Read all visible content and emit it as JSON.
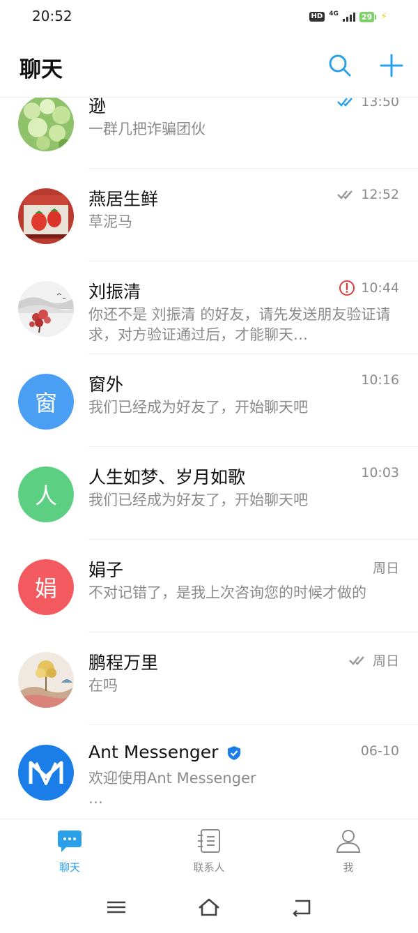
{
  "status_bar": {
    "time": "20:52",
    "hd": "HD",
    "network": "4G",
    "battery": "29"
  },
  "header": {
    "title": "聊天",
    "search_icon": "search-icon",
    "add_icon": "plus-icon"
  },
  "accent_color": "#2aa0e8",
  "chats": [
    {
      "name": "逊",
      "preview": "一群几把诈骗团伙",
      "time": "13:50",
      "status": "read-blue",
      "avatar_type": "photo-flowers"
    },
    {
      "name": "燕居生鲜",
      "preview": "草泥马",
      "time": "12:52",
      "status": "read",
      "avatar_type": "photo-strawberries"
    },
    {
      "name": "刘振清",
      "preview": "你还不是 刘振清 的好友，请先发送朋友验证请求，对方验证通过后，才能聊天…",
      "time": "10:44",
      "status": "error",
      "avatar_type": "photo-painting"
    },
    {
      "name": "窗外",
      "preview": "我们已经成为好友了，开始聊天吧",
      "time": "10:16",
      "status": "none",
      "avatar_letter": "窗",
      "avatar_color": "#4a9ff5"
    },
    {
      "name": "人生如梦、岁月如歌",
      "preview": "我们已经成为好友了，开始聊天吧",
      "time": "10:03",
      "status": "none",
      "avatar_letter": "人",
      "avatar_color": "#5ccf83"
    },
    {
      "name": "娟子",
      "preview": "不对记错了，是我上次咨询您的时候才做的",
      "time": "周日",
      "status": "none",
      "avatar_letter": "娟",
      "avatar_color": "#f25a5f"
    },
    {
      "name": "鹏程万里",
      "preview": "在吗",
      "time": "周日",
      "status": "read",
      "avatar_type": "photo-landscape"
    },
    {
      "name": "Ant Messenger",
      "preview": "欢迎使用Ant Messenger\n…",
      "time": "06-10",
      "status": "none",
      "verified": true,
      "avatar_type": "logo-ant-messenger",
      "avatar_color": "#1a7de8"
    }
  ],
  "tabs": [
    {
      "label": "聊天",
      "icon": "chat-bubble-icon",
      "active": true
    },
    {
      "label": "联系人",
      "icon": "contacts-icon",
      "active": false
    },
    {
      "label": "我",
      "icon": "profile-icon",
      "active": false
    }
  ],
  "nav": {
    "menu_icon": "menu-icon",
    "home_icon": "home-icon",
    "back_icon": "back-icon"
  }
}
